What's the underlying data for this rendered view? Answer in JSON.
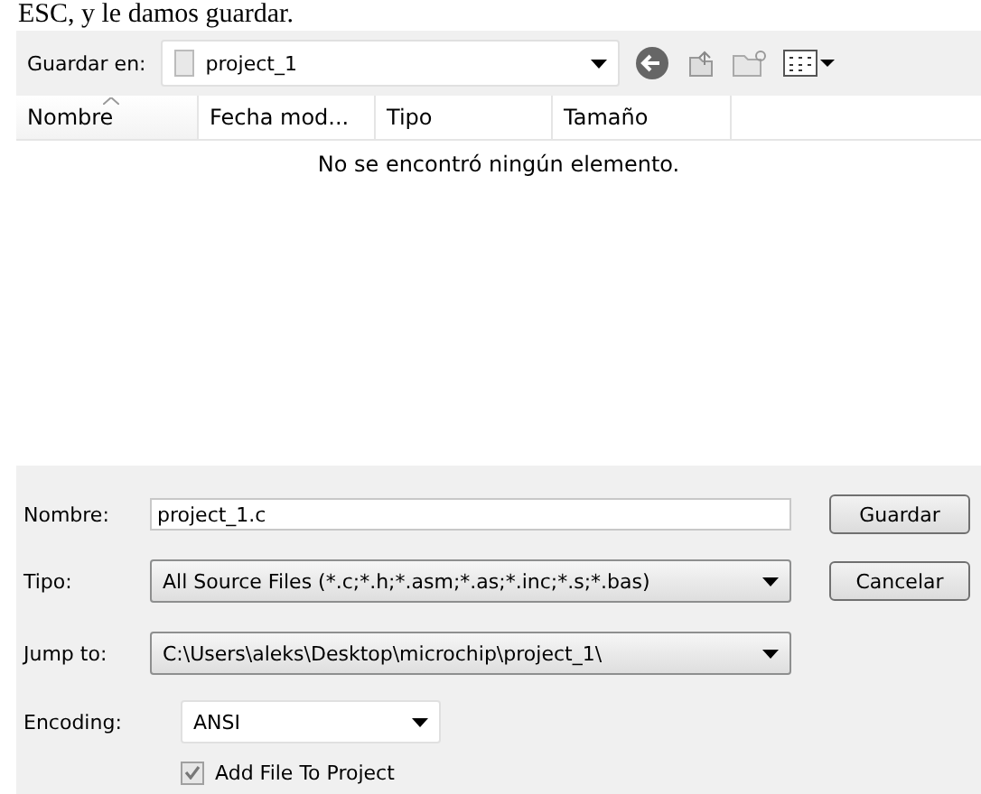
{
  "caption": "ESC, y le damos guardar.",
  "toolbar": {
    "label": "Guardar en:",
    "location": "project_1"
  },
  "columns": [
    {
      "label": "Nombre",
      "sorted": true
    },
    {
      "label": "Fecha mod...",
      "sorted": false
    },
    {
      "label": "Tipo",
      "sorted": false
    },
    {
      "label": "Tamaño",
      "sorted": false
    }
  ],
  "empty_message": "No se encontró ningún elemento.",
  "fields": [
    {
      "kind": "text",
      "label": "Nombre:",
      "value": "project_1.c"
    },
    {
      "kind": "combo",
      "label": "Tipo:",
      "value": "All Source Files (*.c;*.h;*.asm;*.as;*.inc;*.s;*.bas)"
    },
    {
      "kind": "combo",
      "label": "Jump to:",
      "value": "C:\\Users\\aleks\\Desktop\\microchip\\project_1\\"
    },
    {
      "kind": "small-combo",
      "label": "Encoding:",
      "value": "ANSI"
    }
  ],
  "buttons": [
    "Guardar",
    "Cancelar"
  ],
  "add_to_project": {
    "label": "Add File To Project",
    "checked": true
  }
}
